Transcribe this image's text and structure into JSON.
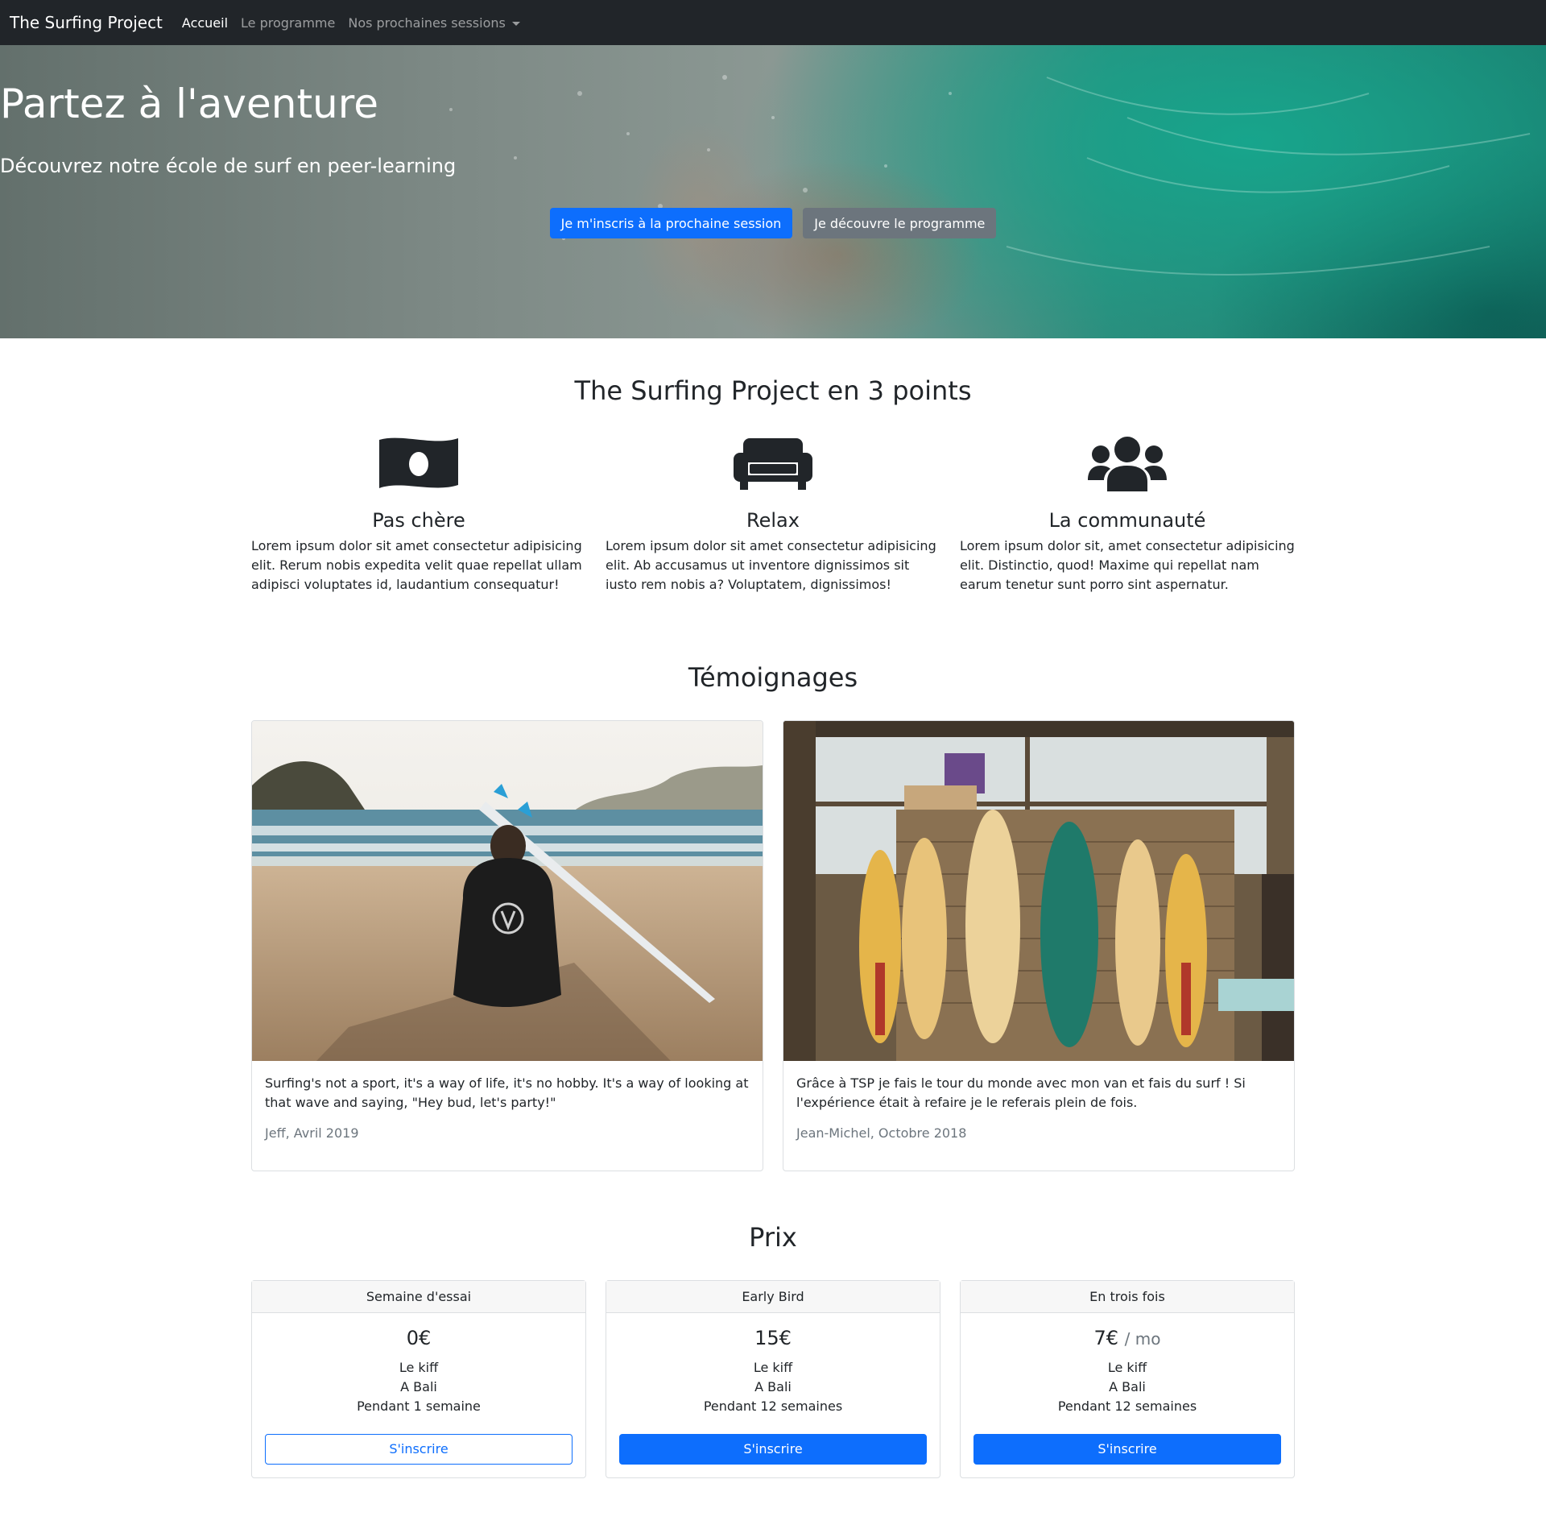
{
  "navbar": {
    "brand": "The Surfing Project",
    "links": [
      "Accueil",
      "Le programme",
      "Nos prochaines sessions"
    ]
  },
  "hero": {
    "title": "Partez à l'aventure",
    "subtitle": "Découvrez notre école de surf en peer-learning",
    "primary_button": "Je m'inscris à la prochaine session",
    "secondary_button": "Je découvre le programme"
  },
  "features": {
    "title": "The Surfing Project en 3 points",
    "items": [
      {
        "icon": "money-bill-icon",
        "title": "Pas chère",
        "text": "Lorem ipsum dolor sit amet consectetur adipisicing elit. Rerum nobis expedita velit quae repellat ullam adipisci voluptates id, laudantium consequatur!"
      },
      {
        "icon": "couch-icon",
        "title": "Relax",
        "text": "Lorem ipsum dolor sit amet consectetur adipisicing elit. Ab accusamus ut inventore dignissimos sit iusto rem nobis a? Voluptatem, dignissimos!"
      },
      {
        "icon": "users-icon",
        "title": "La communauté",
        "text": "Lorem ipsum dolor sit, amet consectetur adipisicing elit. Distinctio, quod! Maxime qui repellat nam earum tenetur sunt porro sint aspernatur."
      }
    ]
  },
  "testimonials": {
    "title": "Témoignages",
    "items": [
      {
        "quote": "Surfing's not a sport, it's a way of life, it's no hobby. It's a way of looking at that wave and saying, \"Hey bud, let's party!\"",
        "author": "Jeff, Avril 2019"
      },
      {
        "quote": "Grâce à TSP je fais le tour du monde avec mon van et fais du surf ! Si l'expérience était à refaire je le referais plein de fois.",
        "author": "Jean-Michel, Octobre 2018"
      }
    ]
  },
  "pricing": {
    "title": "Prix",
    "plans": [
      {
        "name": "Semaine d'essai",
        "price": "0€",
        "per": "",
        "features": [
          "Le kiff",
          "A Bali",
          "Pendant 1 semaine"
        ],
        "button": "S'inscrire"
      },
      {
        "name": "Early Bird",
        "price": "15€",
        "per": "",
        "features": [
          "Le kiff",
          "A Bali",
          "Pendant 12 semaines"
        ],
        "button": "S'inscrire"
      },
      {
        "name": "En trois fois",
        "price": "7€",
        "per": "/ mo",
        "features": [
          "Le kiff",
          "A Bali",
          "Pendant 12 semaines"
        ],
        "button": "S'inscrire"
      }
    ]
  },
  "colors": {
    "primary": "#0d6efd",
    "secondary": "#6c757d",
    "navbar": "#212529"
  }
}
